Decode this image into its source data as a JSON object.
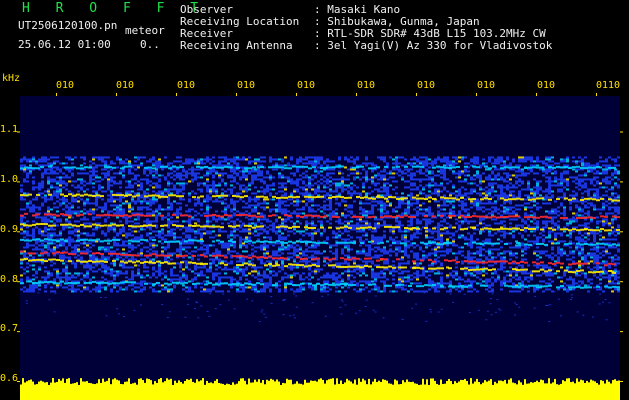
{
  "header": {
    "brand": "H R O F F T",
    "filename": "UT2506120100.pn",
    "filename_suffix": "meteor",
    "datetime": "25.06.12 01:00",
    "extra": "0.."
  },
  "meta": {
    "observer_label": "Observer",
    "observer_value": ": Masaki Kano",
    "location_label": "Receiving Location",
    "location_value": ": Shibukawa, Gunma, Japan",
    "receiver_label": "Receiver",
    "receiver_value": ": RTL-SDR SDR# 43dB L15 103.2MHz CW",
    "antenna_label": "Receiving Antenna",
    "antenna_value": ": 3el Yagi(V) Az 330 for Vladivostok"
  },
  "axis": {
    "y_unit": "kHz",
    "y_ticks": [
      "1.1",
      "1.0",
      "0.9",
      "0.8",
      "0.7",
      "0.6"
    ],
    "time_ticks": [
      "010",
      "010",
      "010",
      "010",
      "010",
      "010",
      "010",
      "010",
      "010",
      "0110"
    ]
  },
  "colors": {
    "background": "#000000",
    "plot_bg": "#000038",
    "label": "#ffe000",
    "brand": "#22e04a",
    "text": "#f0f0f0",
    "signal_low": "#1e40ff",
    "signal_mid": "#00d0ff",
    "signal_high": "#ffee00",
    "signal_peak": "#ff2a2a",
    "noise_bar": "#ffff00"
  }
}
